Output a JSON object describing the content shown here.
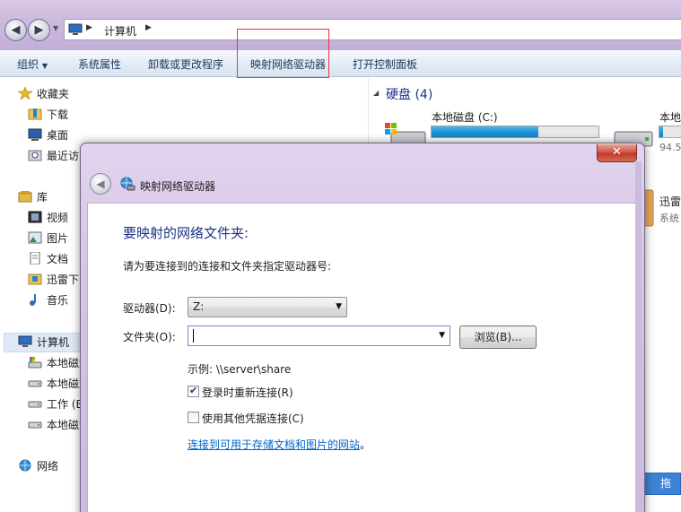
{
  "explorer": {
    "address": {
      "path_text": "计算机"
    },
    "commands": [
      "组织",
      "系统属性",
      "卸载或更改程序",
      "映射网络驱动器",
      "打开控制面板"
    ],
    "nav": {
      "favorites": "收藏夹",
      "downloads": "下载",
      "desktop": "桌面",
      "recent": "最近访",
      "libraries": "库",
      "videos": "视频",
      "pictures": "图片",
      "documents": "文档",
      "thunder": "迅雷下",
      "music": "音乐",
      "computer": "计算机",
      "local_disk_1": "本地磁盘",
      "local_disk_2": "本地磁盘",
      "work": "工作 (E",
      "local_disk_3": "本地磁盘",
      "network": "网络"
    },
    "content": {
      "group_header": "硬盘 (4)",
      "drive_c_name": "本地磁盘 (C:)",
      "drive_c_fill": 0.64,
      "drive_d_name": "本地",
      "drive_d_fill": 0.07,
      "drive_d_size": "94.5",
      "thunder_name": "迅雷",
      "thunder_sub": "系统"
    },
    "baidu_button": "拖拽"
  },
  "dialog": {
    "title": "映射网络驱动器",
    "close_glyph": "✕",
    "heading": "要映射的网络文件夹:",
    "description": "请为要连接到的连接和文件夹指定驱动器号:",
    "drive_label": "驱动器(D):",
    "drive_value": "Z:",
    "folder_label": "文件夹(O):",
    "folder_value": "",
    "browse_label": "浏览(B)...",
    "example": "示例: \\\\server\\share",
    "reconnect_label": "登录时重新连接(R)",
    "reconnect_checked": true,
    "credentials_label": "使用其他凭据连接(C)",
    "credentials_checked": false,
    "link_text": "连接到可用于存储文档和图片的网站",
    "link_suffix": "。"
  },
  "colors": {
    "accent_blue": "#1e3287",
    "link": "#0066cc",
    "drive_fill": "#1f8fd0",
    "highlight": "#e8383a",
    "glass": "#cdb9e0"
  },
  "icons": [
    "back-arrow-icon",
    "forward-arrow-icon",
    "computer-icon",
    "star-icon",
    "folder-icon",
    "desktop-icon",
    "video-icon",
    "picture-icon",
    "document-icon",
    "music-icon",
    "drive-icon",
    "network-icon",
    "network-drive-icon",
    "close-icon",
    "baidu-cloud-icon"
  ]
}
